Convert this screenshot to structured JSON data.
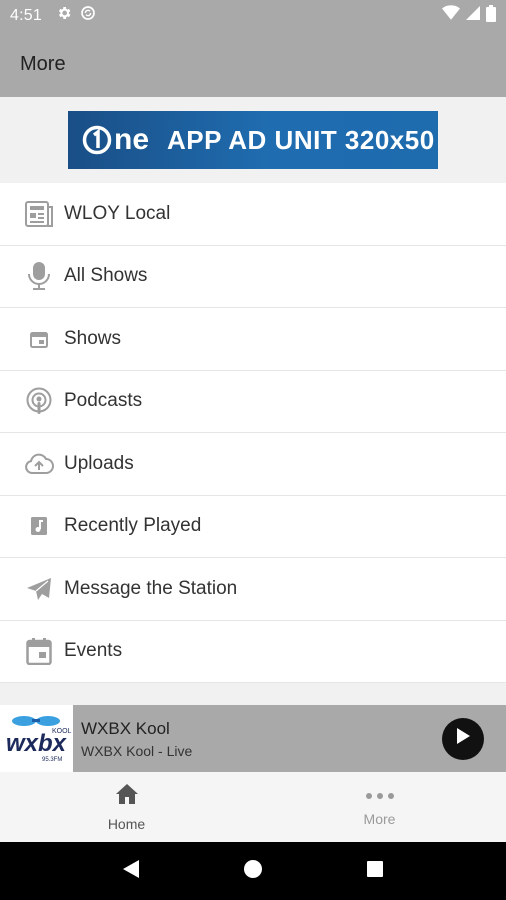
{
  "status_bar": {
    "time": "4:51",
    "icons": [
      "settings-icon",
      "sync-icon",
      "wifi-icon",
      "signal-icon",
      "battery-icon"
    ]
  },
  "app_bar": {
    "title": "More"
  },
  "ad": {
    "logo_text": "ne",
    "text": "APP AD UNIT 320x50"
  },
  "menu": {
    "items": [
      {
        "label": "WLOY Local",
        "icon": "news-icon"
      },
      {
        "label": "All Shows",
        "icon": "microphone-icon"
      },
      {
        "label": "Shows",
        "icon": "calendar-small-icon"
      },
      {
        "label": "Podcasts",
        "icon": "podcast-icon"
      },
      {
        "label": "Uploads",
        "icon": "cloud-upload-icon"
      },
      {
        "label": "Recently Played",
        "icon": "music-note-icon"
      },
      {
        "label": "Message the Station",
        "icon": "send-icon"
      },
      {
        "label": "Events",
        "icon": "calendar-icon"
      }
    ]
  },
  "player": {
    "logo_text": "wxbx",
    "station": "WXBX Kool",
    "subtitle": "WXBX Kool - Live"
  },
  "tabs": [
    {
      "label": "Home",
      "icon": "home-icon"
    },
    {
      "label": "More",
      "icon": "more-dots-icon"
    }
  ],
  "colors": {
    "bar": "#a9a9a9",
    "ad_blue": "#1f6db0",
    "icon_gray": "#9e9e9e"
  }
}
